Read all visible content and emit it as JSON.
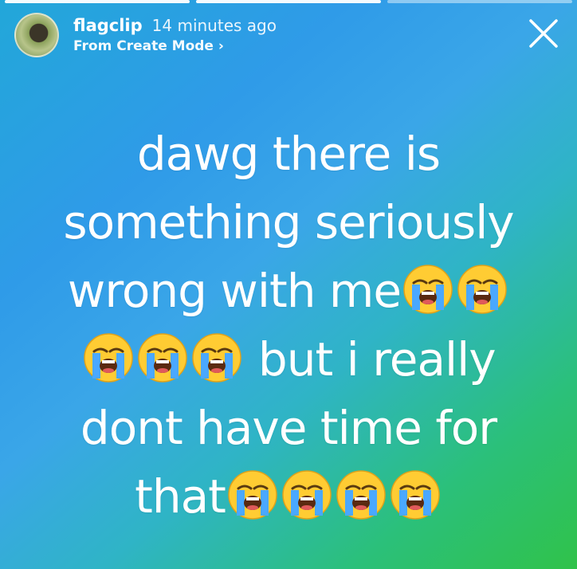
{
  "story": {
    "username": "flagclip",
    "time": "14 minutes ago",
    "source": "From Create Mode ›"
  },
  "caption": {
    "line1": "dawg there is",
    "line2": "something seriously",
    "line3_text": "wrong with me",
    "line4_text": "but i really",
    "line5": "dont have time for",
    "line6_text": "that"
  },
  "icons": {
    "emoji": "loudly-crying-face-icon",
    "close": "close-icon"
  },
  "colors": {
    "gradient_top": "#2f9be8",
    "gradient_bottom": "#30c24a",
    "text": "#ffffff"
  }
}
